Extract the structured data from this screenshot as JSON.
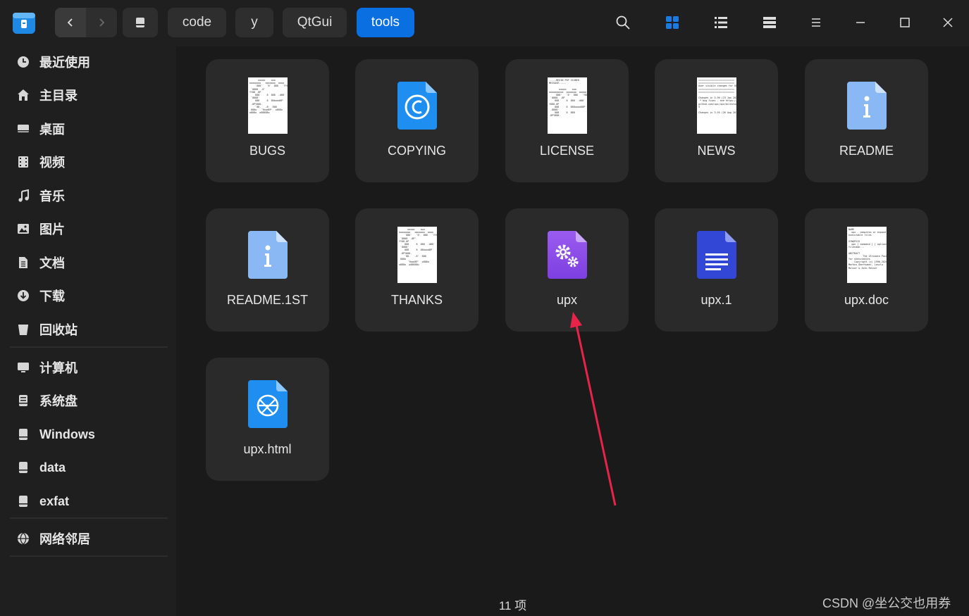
{
  "breadcrumbs": [
    "code",
    "y",
    "QtGui",
    "tools"
  ],
  "sidebar": {
    "items": [
      {
        "label": "最近使用",
        "icon": "clock-icon"
      },
      {
        "label": "主目录",
        "icon": "home-icon"
      },
      {
        "label": "桌面",
        "icon": "desktop-icon"
      },
      {
        "label": "视频",
        "icon": "video-icon"
      },
      {
        "label": "音乐",
        "icon": "music-icon"
      },
      {
        "label": "图片",
        "icon": "image-icon"
      },
      {
        "label": "文档",
        "icon": "document-icon"
      },
      {
        "label": "下载",
        "icon": "download-icon"
      },
      {
        "label": "回收站",
        "icon": "trash-icon"
      },
      {
        "label": "计算机",
        "icon": "computer-icon"
      },
      {
        "label": "系统盘",
        "icon": "system-disk-icon"
      },
      {
        "label": "Windows",
        "icon": "drive-icon"
      },
      {
        "label": "data",
        "icon": "drive-icon"
      },
      {
        "label": "exfat",
        "icon": "drive-icon"
      },
      {
        "label": "网络邻居",
        "icon": "network-icon"
      }
    ]
  },
  "files": [
    {
      "name": "BUGS",
      "type": "text-thumbnail"
    },
    {
      "name": "COPYING",
      "type": "copyright-icon"
    },
    {
      "name": "LICENSE",
      "type": "text-thumbnail"
    },
    {
      "name": "NEWS",
      "type": "text-thumbnail"
    },
    {
      "name": "README",
      "type": "info-icon"
    },
    {
      "name": "README.1ST",
      "type": "info-icon"
    },
    {
      "name": "THANKS",
      "type": "text-thumbnail"
    },
    {
      "name": "upx",
      "type": "executable-icon"
    },
    {
      "name": "upx.1",
      "type": "document-icon"
    },
    {
      "name": "upx.doc",
      "type": "text-thumbnail"
    },
    {
      "name": "upx.html",
      "type": "web-icon"
    }
  ],
  "status": {
    "count": "11 项"
  },
  "watermark": "CSDN @坐公交也用券",
  "colors": {
    "accent": "#0a6fe0",
    "arrow": "#e8234a"
  }
}
